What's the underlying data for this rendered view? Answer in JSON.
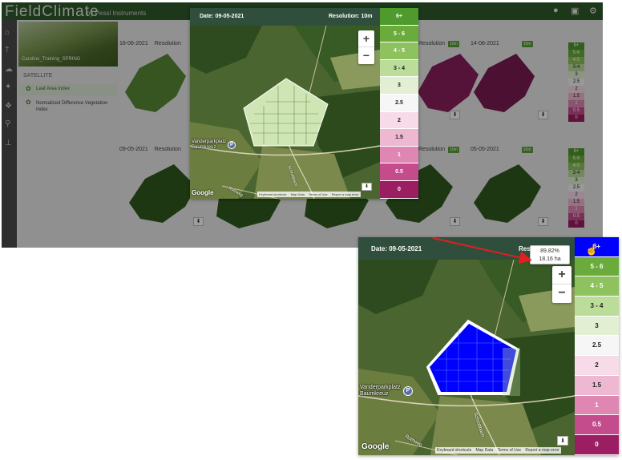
{
  "app": {
    "brand": "FieldClimate",
    "brand_sub": "by Pessl Instruments",
    "farm_name": "Caroline_Training_SPRING",
    "section_label": "SATELLITE",
    "nav": [
      {
        "label": "Leaf Area Index"
      },
      {
        "label": "Normalized Difference Vegetation Index"
      }
    ],
    "resolution_label": "Resolution",
    "resolution_badge": "10m",
    "tiles_row1": [
      {
        "date": "18-06-2021"
      },
      {
        "date": ""
      },
      {
        "date": ""
      },
      {
        "date": ""
      },
      {
        "date": ""
      },
      {
        "date": "14-08-2021"
      }
    ],
    "tiles_row2": [
      {
        "date": "09-05-2021"
      },
      {
        "date": ""
      },
      {
        "date": ""
      },
      {
        "date": ""
      },
      {
        "date": ""
      },
      {
        "date": "05-05-2021"
      }
    ],
    "mini_scale": [
      "6+",
      "5-6",
      "4-5",
      "3-4",
      "3",
      "2.5",
      "2",
      "1.5",
      "1",
      "0.5",
      "0"
    ],
    "download_glyph": "⬇"
  },
  "modal_top": {
    "date": "Date: 09-05-2021",
    "resolution": "Resolution: 10m"
  },
  "modal_bottom": {
    "date": "Date: 09-05-2021",
    "resolution_partial": "Res",
    "tooltip_pct": "89.82%",
    "tooltip_area": "18.16 ha"
  },
  "map": {
    "zoom_in": "+",
    "zoom_out": "−",
    "google": "Google",
    "place_line1": "Vanderparkplatz",
    "place_line2": "Baumkreuz",
    "parking": "P",
    "road_label_a": "Rothweg",
    "road_label_b": "Schwarzbach",
    "road_label_c": "Schrottbach",
    "attribution": [
      "Keyboard shortcuts",
      "Map Data",
      "Terms of Use",
      "Report a map error"
    ],
    "download_glyph": "⬇"
  },
  "legend": [
    {
      "label": "6+",
      "color": "#4e9a2c",
      "text_color": "#ffffff"
    },
    {
      "label": "5 - 6",
      "color": "#6aab3c",
      "text_color": "#ffffff"
    },
    {
      "label": "4 - 5",
      "color": "#8ec25e",
      "text_color": "#ffffff"
    },
    {
      "label": "3 - 4",
      "color": "#bcdc9a",
      "text_color": "#222222"
    },
    {
      "label": "3",
      "color": "#e2efd2",
      "text_color": "#222222"
    },
    {
      "label": "2.5",
      "color": "#f6f6f6",
      "text_color": "#222222"
    },
    {
      "label": "2",
      "color": "#f8dbe8",
      "text_color": "#222222"
    },
    {
      "label": "1.5",
      "color": "#efb8d2",
      "text_color": "#222222"
    },
    {
      "label": "1",
      "color": "#df86b3",
      "text_color": "#ffffff"
    },
    {
      "label": "0.5",
      "color": "#c44c8c",
      "text_color": "#ffffff"
    },
    {
      "label": "0",
      "color": "#9b1e62",
      "text_color": "#ffffff"
    }
  ],
  "colors": {
    "highlight_blue": "#0000ff",
    "field_light_green": "#cfe6b4",
    "arrow_red": "#e02020"
  }
}
